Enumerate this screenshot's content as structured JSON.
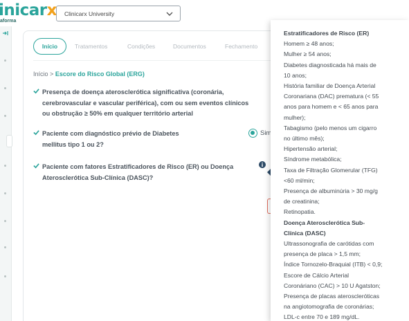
{
  "header": {
    "logo_main": "inicar",
    "logo_accent": "x",
    "logo_sub": "aforma",
    "university_select": "Clinicarx University"
  },
  "tabs": [
    {
      "label": "Início"
    },
    {
      "label": "Tratamentos"
    },
    {
      "label": "Condições"
    },
    {
      "label": "Documentos"
    },
    {
      "label": "Fechamento"
    }
  ],
  "breadcrumb": {
    "root": "Início",
    "sep": ">",
    "current": "Escore do Risco Global (ERG)"
  },
  "questions": [
    {
      "lines": [
        "Presença de doença aterosclerótica significativa (coronária,",
        "cerebrovascular e vascular periférica), com ou sem eventos clínicos",
        "ou obstrução ≥ 50% em qualquer território arterial"
      ]
    },
    {
      "lines": [
        "Paciente com diagnóstico prévio de Diabetes",
        "mellitus tipo 1 ou 2?"
      ]
    },
    {
      "lines": [
        "Paciente com fatores Estratificadores de Risco (ER) ou Doença",
        "Aterosclerótica Sub-Clínica (DASC)?"
      ]
    }
  ],
  "radio_label": "Sim",
  "tooltip": [
    {
      "text": "Estratificadores de Risco (ER)",
      "bold": true
    },
    {
      "text": "Homem ≥ 48 anos;"
    },
    {
      "text": "Mulher ≥ 54 anos;"
    },
    {
      "text": "Diabetes diagnosticada há mais de"
    },
    {
      "text": "10 anos;"
    },
    {
      "text": "História familiar de Doença Arterial"
    },
    {
      "text": "Coronariana (DAC) prematura (< 55"
    },
    {
      "text": "anos para homem e < 65 anos para"
    },
    {
      "text": "mulher);"
    },
    {
      "text": "Tabagismo (pelo menos um cigarro"
    },
    {
      "text": "no último mês);"
    },
    {
      "text": "Hipertensão arterial;"
    },
    {
      "text": "Síndrome metabólica;"
    },
    {
      "text": "Taxa de Filtração Glomerular (TFG)"
    },
    {
      "text": "<60 ml/min;"
    },
    {
      "text": "Presença de albuminúria > 30 mg/g"
    },
    {
      "text": "de creatinina;"
    },
    {
      "text": "Retinopatia."
    },
    {
      "text": "Doença Aterosclerótica Sub-",
      "bold": true
    },
    {
      "text": "Clínica (DASC)",
      "bold": true
    },
    {
      "text": "Ultrassonografia de carótidas com"
    },
    {
      "text": "presença de placa > 1,5 mm;"
    },
    {
      "text": "Índice Tornozelo-Braquial (ITB) < 0,9;"
    },
    {
      "text": "Escore de Cálcio Arterial"
    },
    {
      "text": "Coronáriano (CAC) > 10 U Agatston;"
    },
    {
      "text": "Presença de placas ateroscleróticas"
    },
    {
      "text": "na angiotomografia de coronárias;"
    },
    {
      "text": "LDL-c entre 70 e 189 mg/dL."
    }
  ],
  "colors": {
    "accent": "#2aa49b",
    "logo_x": "#f2a11c"
  }
}
